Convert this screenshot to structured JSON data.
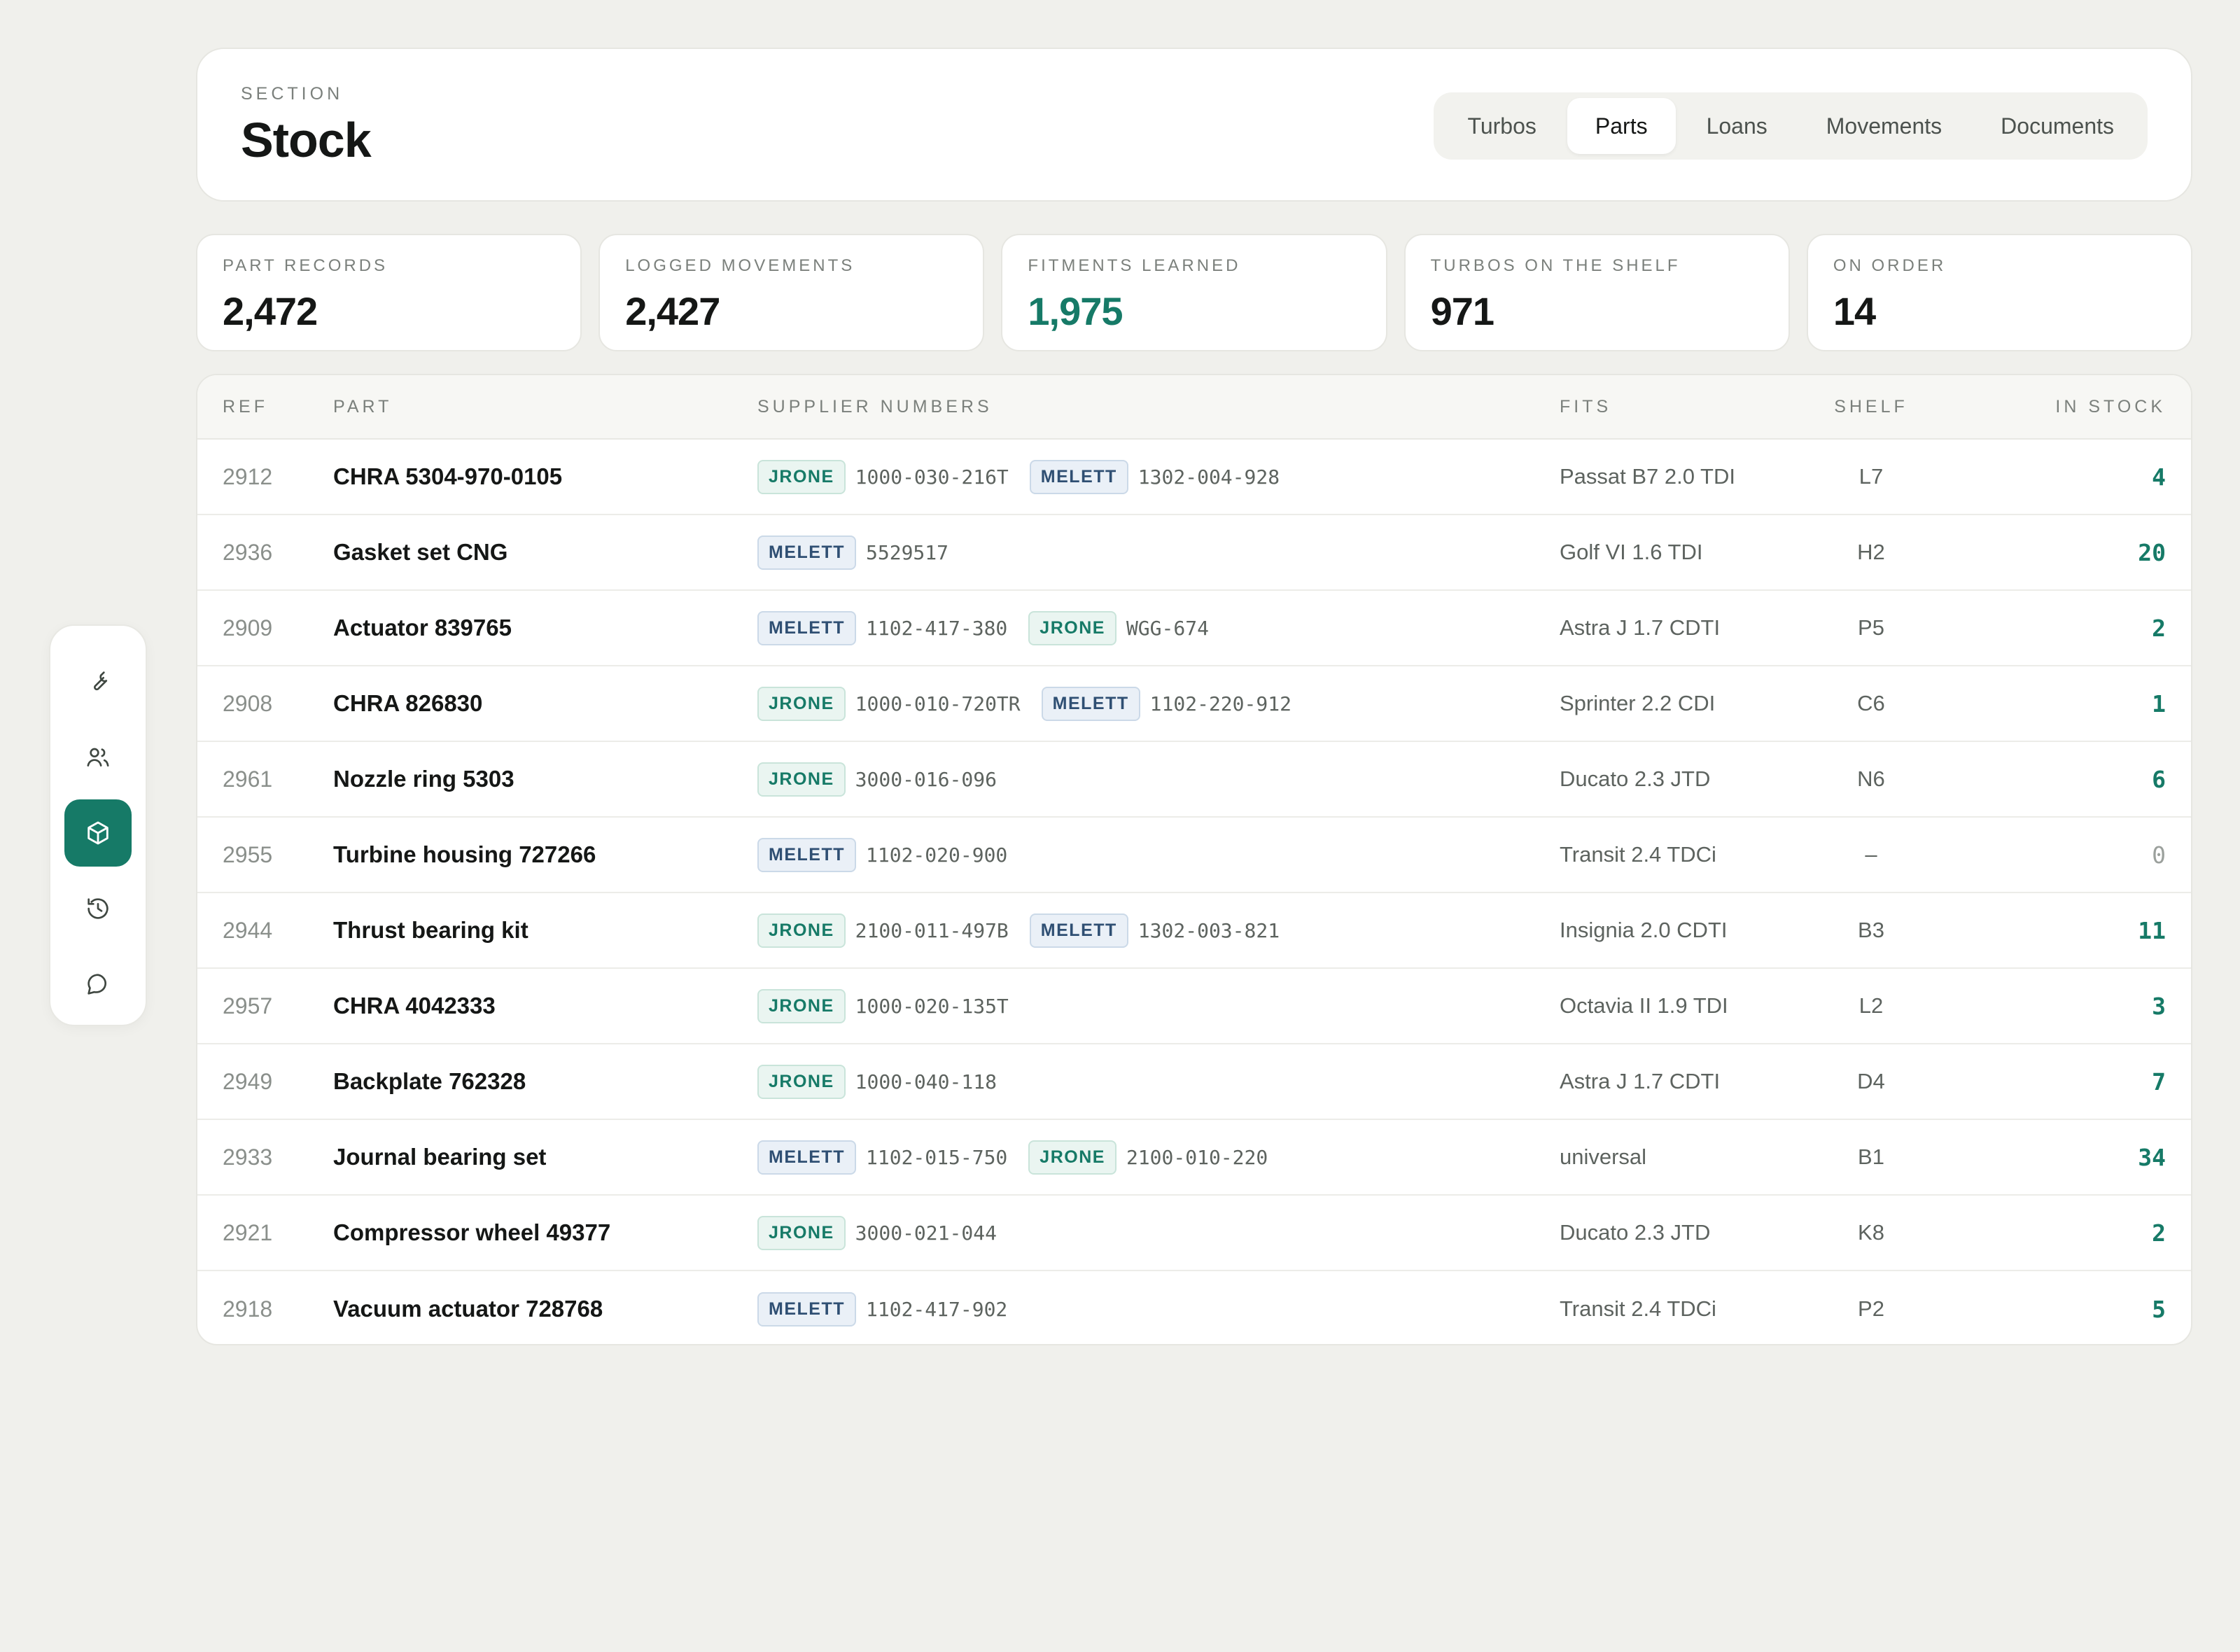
{
  "sidebar": {
    "items": [
      {
        "icon": "wrench-icon",
        "active": false
      },
      {
        "icon": "users-icon",
        "active": false
      },
      {
        "icon": "box-icon",
        "active": true
      },
      {
        "icon": "history-icon",
        "active": false
      },
      {
        "icon": "chat-icon",
        "active": false
      }
    ]
  },
  "header": {
    "eyebrow": "SECTION",
    "title": "Stock",
    "tabs": [
      {
        "label": "Turbos",
        "active": false
      },
      {
        "label": "Parts",
        "active": true
      },
      {
        "label": "Loans",
        "active": false
      },
      {
        "label": "Movements",
        "active": false
      },
      {
        "label": "Documents",
        "active": false
      }
    ]
  },
  "stats": [
    {
      "label": "PART RECORDS",
      "value": "2,472",
      "accent": false
    },
    {
      "label": "LOGGED MOVEMENTS",
      "value": "2,427",
      "accent": false
    },
    {
      "label": "FITMENTS LEARNED",
      "value": "1,975",
      "accent": true
    },
    {
      "label": "TURBOS ON THE SHELF",
      "value": "971",
      "accent": false
    },
    {
      "label": "ON ORDER",
      "value": "14",
      "accent": false
    }
  ],
  "table": {
    "columns": {
      "ref": "REF",
      "part": "PART",
      "suppliers": "SUPPLIER NUMBERS",
      "fits": "FITS",
      "shelf": "SHELF",
      "stock": "IN STOCK"
    },
    "rows": [
      {
        "ref": "2912",
        "part": "CHRA 5304-970-0105",
        "suppliers": [
          {
            "brand": "JRONE",
            "code": "1000-030-216T"
          },
          {
            "brand": "MELETT",
            "code": "1302-004-928"
          }
        ],
        "fits": "Passat B7 2.0 TDI",
        "shelf": "L7",
        "stock": "4"
      },
      {
        "ref": "2936",
        "part": "Gasket set CNG",
        "suppliers": [
          {
            "brand": "MELETT",
            "code": "5529517"
          }
        ],
        "fits": "Golf VI 1.6 TDI",
        "shelf": "H2",
        "stock": "20"
      },
      {
        "ref": "2909",
        "part": "Actuator 839765",
        "suppliers": [
          {
            "brand": "MELETT",
            "code": "1102-417-380"
          },
          {
            "brand": "JRONE",
            "code": "WGG-674"
          }
        ],
        "fits": "Astra J 1.7 CDTI",
        "shelf": "P5",
        "stock": "2"
      },
      {
        "ref": "2908",
        "part": "CHRA 826830",
        "suppliers": [
          {
            "brand": "JRONE",
            "code": "1000-010-720TR"
          },
          {
            "brand": "MELETT",
            "code": "1102-220-912"
          }
        ],
        "fits": "Sprinter 2.2 CDI",
        "shelf": "C6",
        "stock": "1"
      },
      {
        "ref": "2961",
        "part": "Nozzle ring 5303",
        "suppliers": [
          {
            "brand": "JRONE",
            "code": "3000-016-096"
          }
        ],
        "fits": "Ducato 2.3 JTD",
        "shelf": "N6",
        "stock": "6"
      },
      {
        "ref": "2955",
        "part": "Turbine housing 727266",
        "suppliers": [
          {
            "brand": "MELETT",
            "code": "1102-020-900"
          }
        ],
        "fits": "Transit 2.4 TDCi",
        "shelf": "–",
        "stock": "0"
      },
      {
        "ref": "2944",
        "part": "Thrust bearing kit",
        "suppliers": [
          {
            "brand": "JRONE",
            "code": "2100-011-497B"
          },
          {
            "brand": "MELETT",
            "code": "1302-003-821"
          }
        ],
        "fits": "Insignia 2.0 CDTI",
        "shelf": "B3",
        "stock": "11"
      },
      {
        "ref": "2957",
        "part": "CHRA 4042333",
        "suppliers": [
          {
            "brand": "JRONE",
            "code": "1000-020-135T"
          }
        ],
        "fits": "Octavia II 1.9 TDI",
        "shelf": "L2",
        "stock": "3"
      },
      {
        "ref": "2949",
        "part": "Backplate 762328",
        "suppliers": [
          {
            "brand": "JRONE",
            "code": "1000-040-118"
          }
        ],
        "fits": "Astra J 1.7 CDTI",
        "shelf": "D4",
        "stock": "7"
      },
      {
        "ref": "2933",
        "part": "Journal bearing set",
        "suppliers": [
          {
            "brand": "MELETT",
            "code": "1102-015-750"
          },
          {
            "brand": "JRONE",
            "code": "2100-010-220"
          }
        ],
        "fits": "universal",
        "shelf": "B1",
        "stock": "34"
      },
      {
        "ref": "2921",
        "part": "Compressor wheel 49377",
        "suppliers": [
          {
            "brand": "JRONE",
            "code": "3000-021-044"
          }
        ],
        "fits": "Ducato 2.3 JTD",
        "shelf": "K8",
        "stock": "2"
      },
      {
        "ref": "2918",
        "part": "Vacuum actuator 728768",
        "suppliers": [
          {
            "brand": "MELETT",
            "code": "1102-417-902"
          }
        ],
        "fits": "Transit 2.4 TDCi",
        "shelf": "P2",
        "stock": "5"
      }
    ]
  },
  "colors": {
    "accent": "#167a67",
    "background": "#f0f0ec"
  }
}
